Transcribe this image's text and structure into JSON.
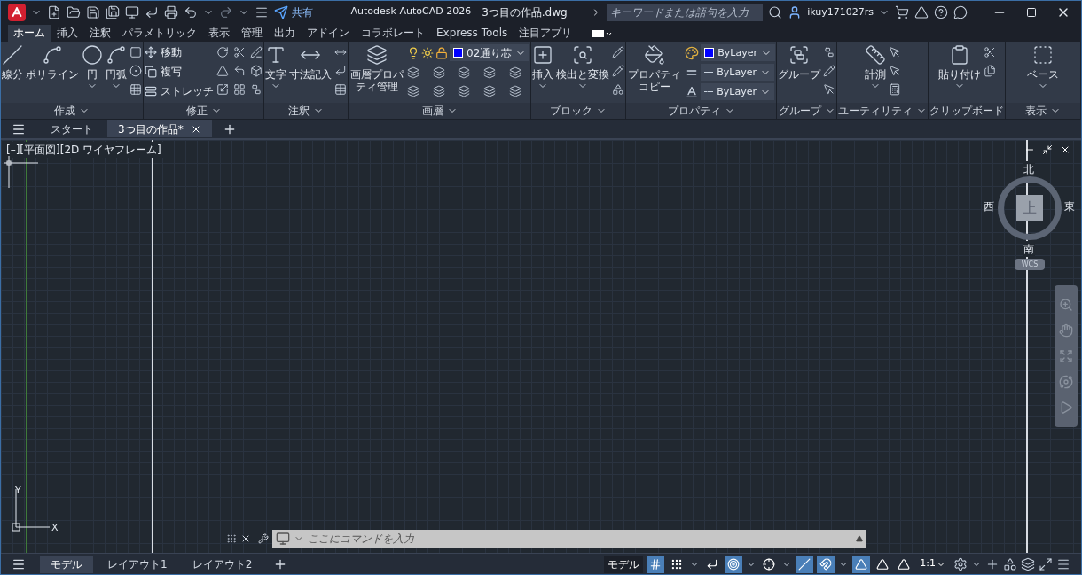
{
  "title_bar": {
    "share": "共有",
    "app": "Autodesk AutoCAD 2026",
    "file": "3つ目の作品.dwg",
    "search": {
      "placeholder": "キーワードまたは語句を入力"
    },
    "user": "ikuy171027rs"
  },
  "ribbon_tabs": [
    {
      "label": "ホーム",
      "selected": true
    },
    {
      "label": "挿入",
      "selected": false
    },
    {
      "label": "注釈",
      "selected": false
    },
    {
      "label": "パラメトリック",
      "selected": false
    },
    {
      "label": "表示",
      "selected": false
    },
    {
      "label": "管理",
      "selected": false
    },
    {
      "label": "出力",
      "selected": false
    },
    {
      "label": "アドイン",
      "selected": false
    },
    {
      "label": "コラボレート",
      "selected": false
    },
    {
      "label": "Express Tools",
      "selected": false
    },
    {
      "label": "注目アプリ",
      "selected": false
    }
  ],
  "panels": [
    {
      "title": "作成",
      "menu": true,
      "tools": [
        {
          "kind": "large",
          "label": "線分",
          "menu": false
        },
        {
          "kind": "large",
          "label": "ポリライン",
          "menu": false
        },
        {
          "kind": "large",
          "label": "円",
          "menu": true
        },
        {
          "kind": "large",
          "label": "円弧",
          "menu": true
        }
      ]
    },
    {
      "title": "修正",
      "menu": true,
      "tools": [
        {
          "kind": "small",
          "label": "移動"
        },
        {
          "kind": "small",
          "label": "複写"
        },
        {
          "kind": "small",
          "label": "ストレッチ"
        }
      ]
    },
    {
      "title": "注釈",
      "menu": true,
      "tools": [
        {
          "kind": "large",
          "label": "文字",
          "menu": true
        },
        {
          "kind": "large",
          "label": "寸法記入",
          "menu": false
        }
      ]
    },
    {
      "title": "画層",
      "menu": true,
      "tools": [
        {
          "kind": "large",
          "label": "画層プロパティ管理",
          "menu": false
        }
      ],
      "dropdowns": [
        {
          "kind": "layer",
          "value": "02通り芯",
          "color": "#0000ff"
        }
      ]
    },
    {
      "title": "ブロック",
      "menu": true,
      "tools": [
        {
          "kind": "large",
          "label": "挿入",
          "menu": true
        },
        {
          "kind": "large",
          "label": "検出と変換",
          "menu": true
        }
      ]
    },
    {
      "title": "プロパティ",
      "menu": true,
      "tools": [
        {
          "kind": "large",
          "label": "プロパティコピー",
          "menu": false
        }
      ],
      "dropdowns": [
        {
          "kind": "color",
          "value": "ByLayer",
          "color": "#0000ff"
        },
        {
          "kind": "lineweight",
          "value": "ByLayer"
        },
        {
          "kind": "linetype",
          "value": "ByLayer"
        }
      ]
    },
    {
      "title": "グループ",
      "menu": true,
      "tools": [
        {
          "kind": "large",
          "label": "グループ",
          "menu": false
        }
      ]
    },
    {
      "title": "ユーティリティ",
      "menu": true,
      "tools": [
        {
          "kind": "large",
          "label": "計測",
          "menu": true
        }
      ]
    },
    {
      "title": "クリップボード",
      "menu": false,
      "tools": [
        {
          "kind": "large",
          "label": "貼り付け",
          "menu": true
        }
      ]
    },
    {
      "title": "表示",
      "menu": true,
      "tools": [
        {
          "kind": "large",
          "label": "ベース",
          "menu": true
        }
      ]
    }
  ],
  "document_tabs": [
    {
      "label": "スタート",
      "selected": false,
      "closable": false
    },
    {
      "label": "3つ目の作品*",
      "selected": true,
      "closable": true
    }
  ],
  "viewport": {
    "label": "[–][平面図][2D ワイヤフレーム]",
    "viewcube": {
      "north": "北",
      "west": "西",
      "top": "上",
      "east": "東",
      "south": "南",
      "ucs": "WCS"
    },
    "ucs_axes": {
      "y": "Y",
      "x": "X"
    }
  },
  "command_line": {
    "placeholder": "ここにコマンドを入力"
  },
  "layout_tabs": [
    {
      "label": "モデル",
      "selected": true
    },
    {
      "label": "レイアウト1",
      "selected": false
    },
    {
      "label": "レイアウト2",
      "selected": false
    }
  ],
  "status_bar": {
    "space": "モデル",
    "toggles": [
      {
        "on": true,
        "menu": false
      },
      {
        "on": false,
        "menu": true
      },
      {
        "on": false,
        "menu": false
      },
      {
        "on": true,
        "menu": true
      },
      {
        "on": false,
        "menu": true
      },
      {
        "on": true,
        "menu": false
      },
      {
        "on": true,
        "menu": true
      },
      {
        "on": true,
        "menu": false
      },
      {
        "on": false,
        "menu": false
      },
      {
        "on": false,
        "menu": false
      }
    ],
    "scale": "1:1"
  }
}
